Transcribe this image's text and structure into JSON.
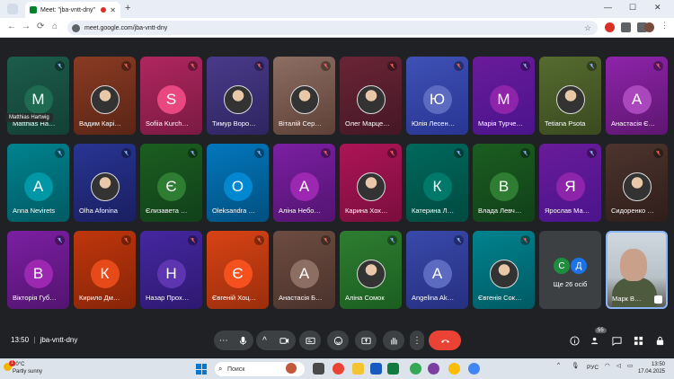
{
  "browser": {
    "tab_title": "Meet: \"jba-vntt-dny\"",
    "tab_close": "✕",
    "new_tab": "+",
    "url": "meet.google.com/jba-vntt-dny",
    "back": "←",
    "forward": "→",
    "reload": "⟳",
    "home": "⌂",
    "win_min": "—",
    "win_max": "☐",
    "win_close": "✕"
  },
  "participants": [
    {
      "name": "Matthias Ha…",
      "initial": "M",
      "bg": [
        "#1c5c4a",
        "#134035"
      ],
      "avatar_bg": "#1e6b52",
      "photo": false,
      "mic_color": "#8ab4f8"
    },
    {
      "name": "Вадим Карі…",
      "initial": "",
      "bg": [
        "#8a3b23",
        "#5a2516"
      ],
      "avatar_bg": "#333",
      "photo": true,
      "mic_color": "#ee675c"
    },
    {
      "name": "Sofiia Kurch…",
      "initial": "S",
      "bg": [
        "#b0265f",
        "#7a1a43"
      ],
      "avatar_bg": "#e8487f",
      "photo": false,
      "mic_color": "#ee675c"
    },
    {
      "name": "Тимур Воро…",
      "initial": "",
      "bg": [
        "#4a3a8a",
        "#2e2560"
      ],
      "avatar_bg": "#c62828",
      "photo": true,
      "mic_color": "#ee675c"
    },
    {
      "name": "Віталій Сер…",
      "initial": "",
      "bg": [
        "#8d6e63",
        "#5d4037"
      ],
      "avatar_bg": "#ddd",
      "photo": true,
      "mic_color": "#ee675c"
    },
    {
      "name": "Олег Марце…",
      "initial": "",
      "bg": [
        "#6a2536",
        "#451726"
      ],
      "avatar_bg": "#333",
      "photo": true,
      "mic_color": "#ee675c"
    },
    {
      "name": "Юлія Лесен…",
      "initial": "Ю",
      "bg": [
        "#3f51b5",
        "#283593"
      ],
      "avatar_bg": "#5c6bc0",
      "photo": false,
      "mic_color": "#ee675c"
    },
    {
      "name": "Марія Турче…",
      "initial": "М",
      "bg": [
        "#6a1b9a",
        "#4a148c"
      ],
      "avatar_bg": "#8e24aa",
      "photo": false,
      "mic_color": "#8ab4f8"
    },
    {
      "name": "Tetiana Psota",
      "initial": "",
      "bg": [
        "#556b2f",
        "#3a4a20"
      ],
      "avatar_bg": "#c8a070",
      "photo": true,
      "mic_color": "#8ab4f8"
    },
    {
      "name": "Анастасія Є…",
      "initial": "А",
      "bg": [
        "#8e24aa",
        "#5e1670"
      ],
      "avatar_bg": "#ab47bc",
      "photo": false,
      "mic_color": "#ee675c"
    },
    {
      "name": "Anna Nevirets",
      "initial": "A",
      "bg": [
        "#00838f",
        "#005a63"
      ],
      "avatar_bg": "#0097a7",
      "photo": false,
      "mic_color": "#8ab4f8"
    },
    {
      "name": "Olha Afonina",
      "initial": "",
      "bg": [
        "#283593",
        "#1a1f60"
      ],
      "avatar_bg": "#222",
      "photo": true,
      "mic_color": "#8ab4f8"
    },
    {
      "name": "Єлизавета …",
      "initial": "Є",
      "bg": [
        "#1b5e20",
        "#11401a"
      ],
      "avatar_bg": "#2e7d32",
      "photo": false,
      "mic_color": "#8ab4f8"
    },
    {
      "name": "Oleksandra …",
      "initial": "O",
      "bg": [
        "#0277bd",
        "#01507f"
      ],
      "avatar_bg": "#0288d1",
      "photo": false,
      "mic_color": "#8ab4f8"
    },
    {
      "name": "Аліна Небо…",
      "initial": "А",
      "bg": [
        "#7b1fa2",
        "#531470"
      ],
      "avatar_bg": "#9c27b0",
      "photo": false,
      "mic_color": "#ee675c"
    },
    {
      "name": "Карина Хох…",
      "initial": "",
      "bg": [
        "#ad1457",
        "#7a0e3d"
      ],
      "avatar_bg": "#6a8a3a",
      "photo": true,
      "mic_color": "#ee675c"
    },
    {
      "name": "Катерина Л…",
      "initial": "К",
      "bg": [
        "#00695c",
        "#004a40"
      ],
      "avatar_bg": "#00796b",
      "photo": false,
      "mic_color": "#8ab4f8"
    },
    {
      "name": "Влада Левч…",
      "initial": "В",
      "bg": [
        "#1b5e20",
        "#11401a"
      ],
      "avatar_bg": "#2e7d32",
      "photo": false,
      "mic_color": "#8ab4f8"
    },
    {
      "name": "Ярослав Ма…",
      "initial": "Я",
      "bg": [
        "#6a1b9a",
        "#4a148c"
      ],
      "avatar_bg": "#8e24aa",
      "photo": false,
      "mic_color": "#8ab4f8"
    },
    {
      "name": "Сидоренко …",
      "initial": "",
      "bg": [
        "#4e342e",
        "#2e1e1a"
      ],
      "avatar_bg": "#8a6a20",
      "photo": true,
      "mic_color": "#ee675c"
    },
    {
      "name": "Вікторія Губ…",
      "initial": "В",
      "bg": [
        "#7b1fa2",
        "#531470"
      ],
      "avatar_bg": "#9c27b0",
      "photo": false,
      "mic_color": "#8ab4f8"
    },
    {
      "name": "Кирило Дм…",
      "initial": "К",
      "bg": [
        "#bf360c",
        "#872508"
      ],
      "avatar_bg": "#e64a19",
      "photo": false,
      "mic_color": "#ee675c"
    },
    {
      "name": "Назар Прох…",
      "initial": "Н",
      "bg": [
        "#4527a0",
        "#2d1970"
      ],
      "avatar_bg": "#5e35b1",
      "photo": false,
      "mic_color": "#ee675c"
    },
    {
      "name": "Євгеній Хоц…",
      "initial": "Є",
      "bg": [
        "#d84315",
        "#9a2e0c"
      ],
      "avatar_bg": "#f4511e",
      "photo": false,
      "mic_color": "#ee675c"
    },
    {
      "name": "Анастасія Б…",
      "initial": "А",
      "bg": [
        "#6d4c41",
        "#4a332c"
      ],
      "avatar_bg": "#8d6e63",
      "photo": false,
      "mic_color": "#ee675c"
    },
    {
      "name": "Аліна Сомок",
      "initial": "",
      "bg": [
        "#2e7d32",
        "#1b5e20"
      ],
      "avatar_bg": "#aab",
      "photo": true,
      "mic_color": "#8ab4f8"
    },
    {
      "name": "Angelina Ak…",
      "initial": "A",
      "bg": [
        "#3949ab",
        "#263080"
      ],
      "avatar_bg": "#5c6bc0",
      "photo": false,
      "mic_color": "#8ab4f8"
    },
    {
      "name": "Євгенія Сок…",
      "initial": "",
      "bg": [
        "#00838f",
        "#005a63"
      ],
      "avatar_bg": "#6aa0c0",
      "photo": true,
      "mic_color": "#ee675c"
    }
  ],
  "hover_tooltip": "Matthias Hartwig",
  "more": {
    "initial1": "С",
    "initial2": "Д",
    "label": "Ще 26 осіб"
  },
  "self": {
    "name": "Марк В…"
  },
  "meeting": {
    "time": "13:50",
    "separator": "|",
    "code": "jba-vntt-dny"
  },
  "controls": {
    "more_dots": "⋯",
    "chevron": "^",
    "people_count": "55"
  },
  "taskbar": {
    "temp": "20°C",
    "weather_desc": "Partly sunny",
    "alert_count": "1",
    "search_label": "Поиск",
    "lang": "РУС",
    "clock_time": "13:50",
    "clock_date": "17.04.2025",
    "tray_arrow": "^"
  }
}
